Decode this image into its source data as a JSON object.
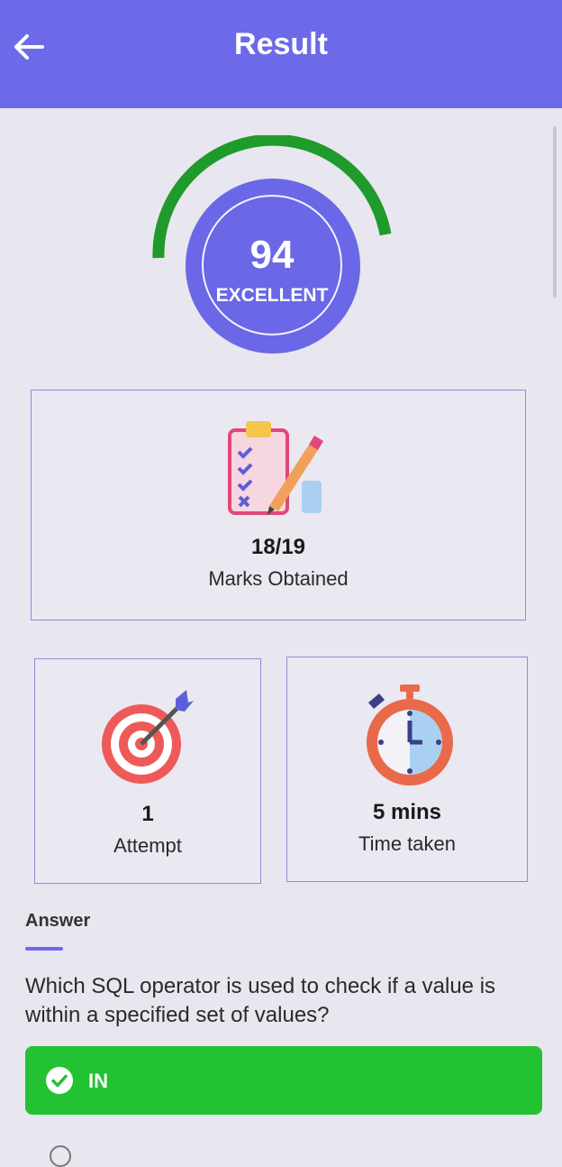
{
  "header": {
    "title": "Result",
    "back_icon": "arrow-left-icon"
  },
  "score": {
    "value": "94",
    "label": "EXCELLENT",
    "gauge_color": "#1e9b2a",
    "circle_color": "#6a68e6"
  },
  "marks": {
    "value": "18/19",
    "label": "Marks Obtained",
    "icon": "clipboard-checklist-icon"
  },
  "attempt": {
    "value": "1",
    "label": "Attempt",
    "icon": "target-dart-icon"
  },
  "time": {
    "value": "5 mins",
    "label": "Time taken",
    "icon": "stopwatch-icon"
  },
  "answer_section": {
    "label": "Answer",
    "question": "Which SQL operator is used to check if a value is within a specified set of values?",
    "correct_option": "IN",
    "correct_color": "#22c232",
    "check_icon": "check-circle-icon"
  },
  "colors": {
    "accent": "#6c6ae8",
    "background": "#e8e6ee"
  }
}
